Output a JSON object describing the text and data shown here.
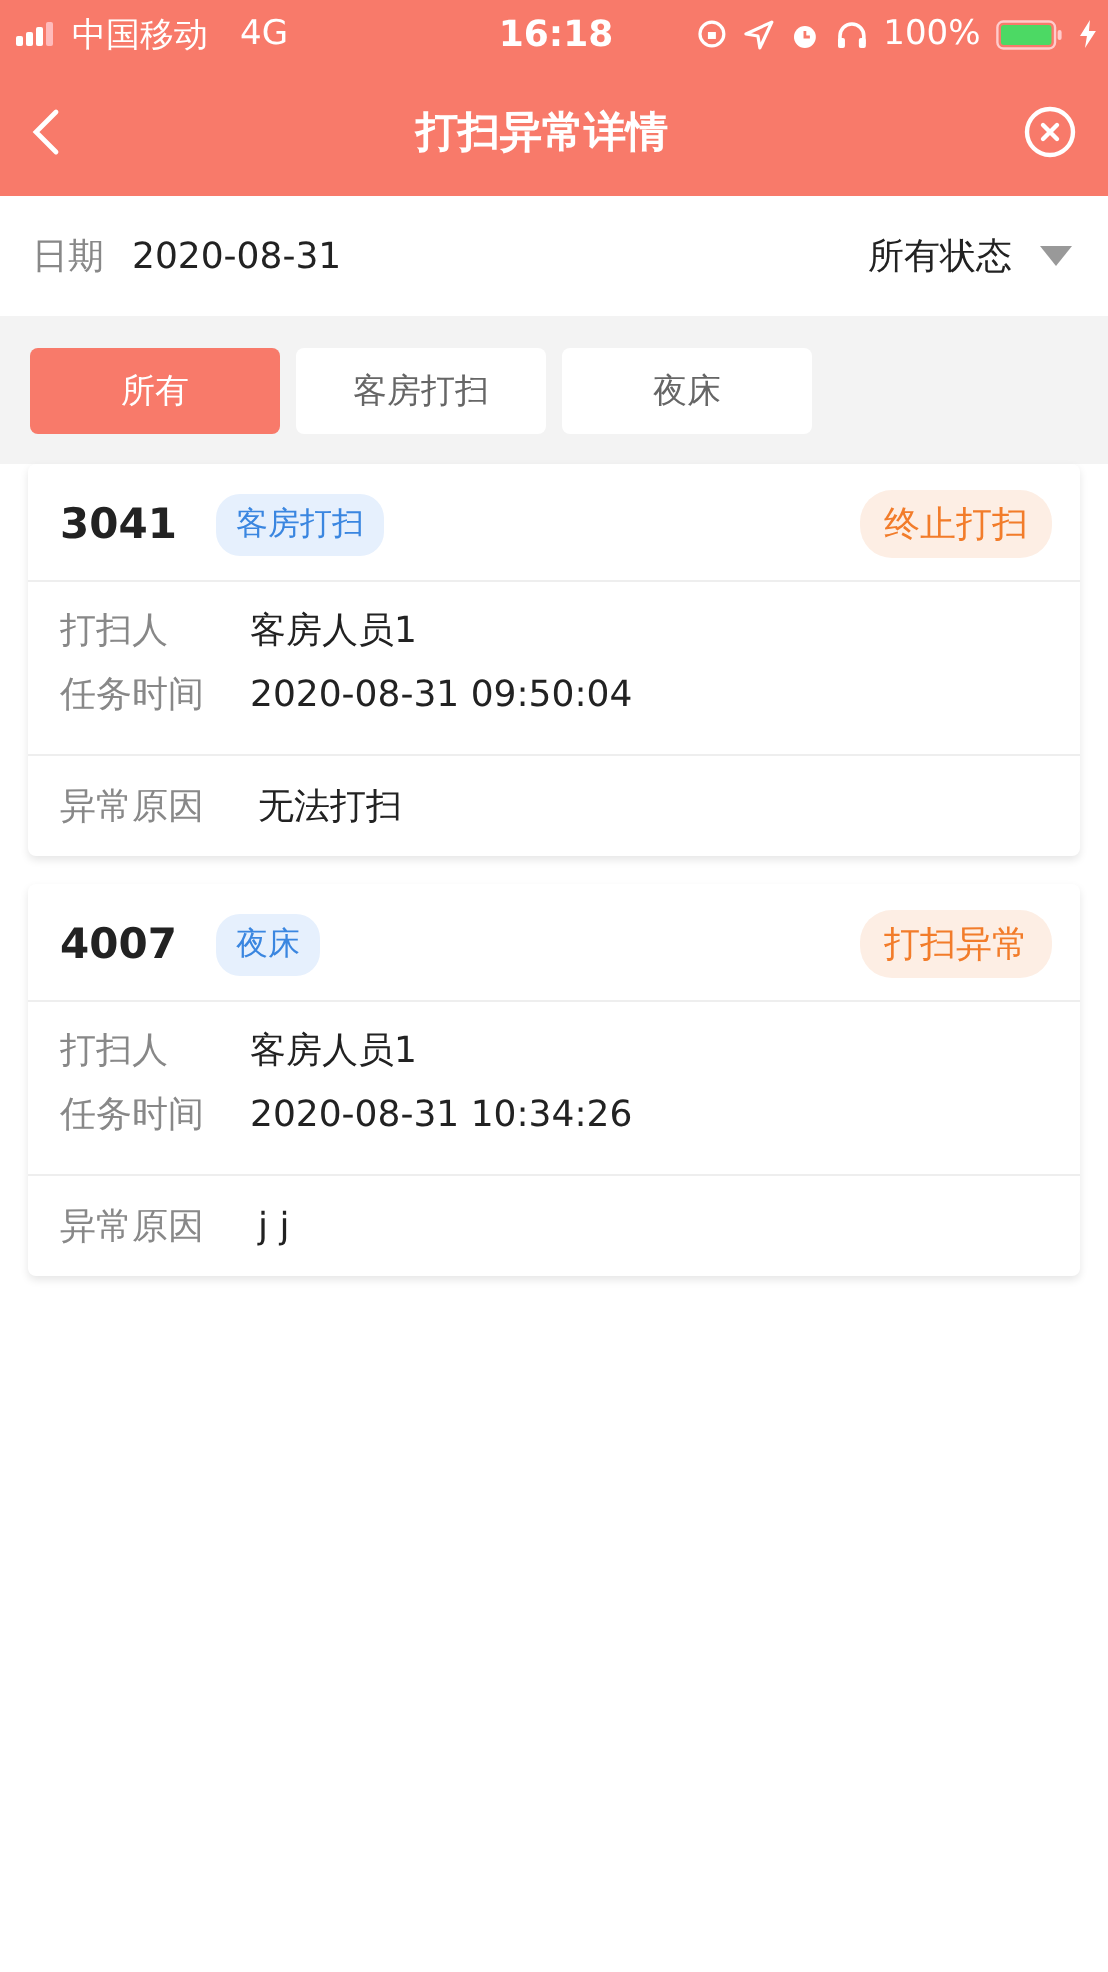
{
  "status_bar": {
    "carrier": "中国移动",
    "network": "4G",
    "time": "16:18",
    "battery": "100%"
  },
  "nav": {
    "title": "打扫异常详情"
  },
  "filter": {
    "date_label": "日期",
    "date": "2020-08-31",
    "status": "所有状态"
  },
  "tabs": [
    {
      "label": "所有",
      "selected": true
    },
    {
      "label": "客房打扫",
      "selected": false
    },
    {
      "label": "夜床",
      "selected": false
    }
  ],
  "records": [
    {
      "room": "3041",
      "type": "客房打扫",
      "status": "终止打扫",
      "fields": [
        {
          "label": "打扫人",
          "value": "客房人员1"
        },
        {
          "label": "任务时间",
          "value": "2020-08-31 09:50:04"
        }
      ],
      "reason_label": "异常原因",
      "reason": "无法打扫"
    },
    {
      "room": "4007",
      "type": "夜床",
      "status": "打扫异常",
      "fields": [
        {
          "label": "打扫人",
          "value": "客房人员1"
        },
        {
          "label": "任务时间",
          "value": "2020-08-31 10:34:26"
        }
      ],
      "reason_label": "异常原因",
      "reason": "j j"
    }
  ]
}
